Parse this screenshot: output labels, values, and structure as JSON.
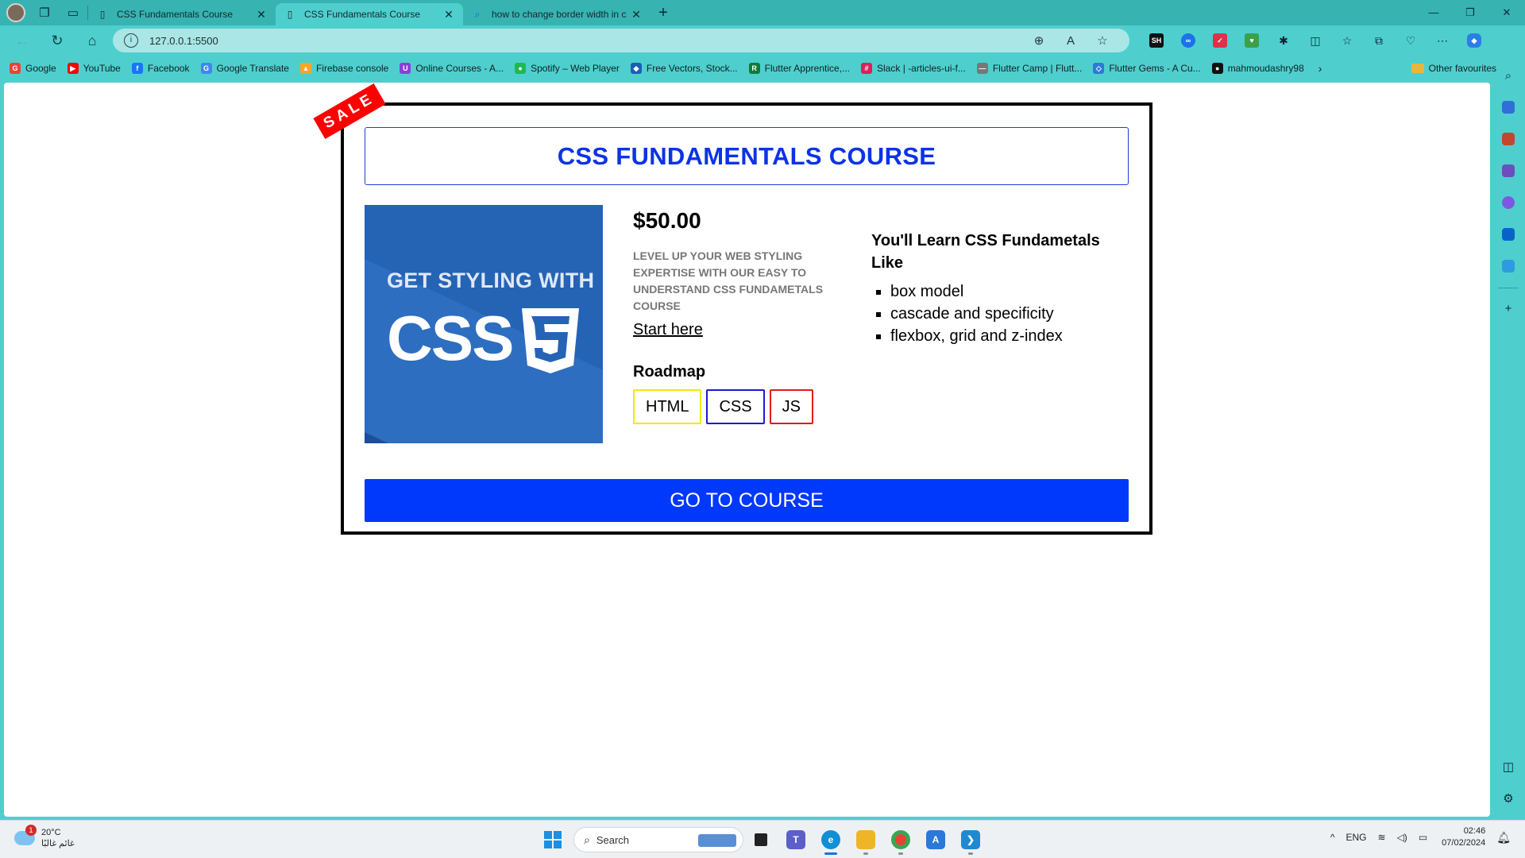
{
  "tabs": [
    {
      "title": "CSS Fundamentals Course",
      "active": false
    },
    {
      "title": "CSS Fundamentals Course",
      "active": true
    },
    {
      "title": "how to change border width in c",
      "active": false
    }
  ],
  "address": {
    "url": "127.0.0.1:5500"
  },
  "bookmarks": [
    {
      "label": "Google",
      "color": "#ea4335",
      "glyph": "G"
    },
    {
      "label": "YouTube",
      "color": "#ff0000",
      "glyph": "▶"
    },
    {
      "label": "Facebook",
      "color": "#1877f2",
      "glyph": "f"
    },
    {
      "label": "Google Translate",
      "color": "#4285f4",
      "glyph": "G"
    },
    {
      "label": "Firebase console",
      "color": "#f6a623",
      "glyph": "▲"
    },
    {
      "label": "Online Courses - A...",
      "color": "#8b3dde",
      "glyph": "U"
    },
    {
      "label": "Spotify – Web Player",
      "color": "#1db954",
      "glyph": "●"
    },
    {
      "label": "Free Vectors, Stock...",
      "color": "#1a5fb4",
      "glyph": "◆"
    },
    {
      "label": "Flutter Apprentice,...",
      "color": "#0f7a3a",
      "glyph": "R"
    },
    {
      "label": "Slack | -articles-ui-f...",
      "color": "#e01e5a",
      "glyph": "#"
    },
    {
      "label": "Flutter Camp | Flutt...",
      "color": "#777777",
      "glyph": "—"
    },
    {
      "label": "Flutter Gems - A Cu...",
      "color": "#2b7bd6",
      "glyph": "◇"
    },
    {
      "label": "mahmoudashry98",
      "color": "#111111",
      "glyph": "●"
    }
  ],
  "bookmarks_other": "Other favourites",
  "course": {
    "ribbon": "SALE",
    "title": "CSS FUNDAMENTALS COURSE",
    "thumb_tagline": "GET STYLING WITH",
    "thumb_word": "CSS",
    "price": "$50.00",
    "tagline": "LEVEL UP YOUR WEB STYLING EXPERTISE WITH OUR EASY TO UNDERSTAND CSS FUNDAMETALS COURSE",
    "start_link": "Start here",
    "roadmap_heading": "Roadmap",
    "roadmap": [
      {
        "label": "HTML",
        "color": "#f5e60a"
      },
      {
        "label": "CSS",
        "color": "#1a1ad6"
      },
      {
        "label": "JS",
        "color": "#e21b1b"
      }
    ],
    "learn_heading": "You'll Learn CSS Fundametals Like",
    "learn_items": [
      "box model",
      "cascade and specificity",
      "flexbox, grid and z-index"
    ],
    "cta": "GO TO COURSE"
  },
  "taskbar": {
    "temp": "20°C",
    "weather_desc": "غائم غالبًا",
    "weather_badge": "1",
    "search_placeholder": "Search",
    "lang": "ENG",
    "time": "02:46",
    "date": "07/02/2024"
  },
  "colors": {
    "browser_frame": "#4ecfce",
    "title_blue": "#0b33e6",
    "cta_blue": "#0038fc",
    "ribbon_red": "#ff0000"
  }
}
